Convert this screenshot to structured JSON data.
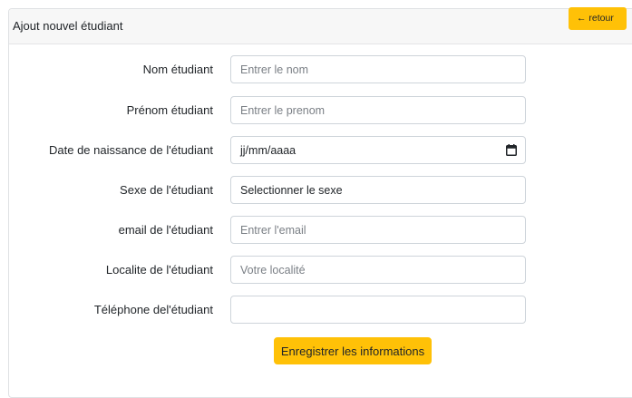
{
  "header": {
    "title": "Ajout nouvel étudiant",
    "back_label": "← retour"
  },
  "form": {
    "nom": {
      "label": "Nom étudiant",
      "placeholder": "Entrer le nom"
    },
    "prenom": {
      "label": "Prénom étudiant",
      "placeholder": "Entrer le prenom"
    },
    "date_naissance": {
      "label": "Date de naissance de l'étudiant",
      "value": "jj/mm/aaaa"
    },
    "sexe": {
      "label": "Sexe de l'étudiant",
      "value": "Selectionner le sexe"
    },
    "email": {
      "label": "email de l'étudiant",
      "placeholder": "Entrer l'email"
    },
    "localite": {
      "label": "Localite de l'étudiant",
      "placeholder": "Votre localité"
    },
    "telephone": {
      "label": "Téléphone del'étudiant",
      "placeholder": ""
    },
    "submit_label": "Enregistrer les informations"
  },
  "icons": {
    "calendar": "calendar-icon"
  },
  "colors": {
    "accent": "#ffc107",
    "header_bg": "#f7f7f7",
    "border": "#ced4da"
  }
}
